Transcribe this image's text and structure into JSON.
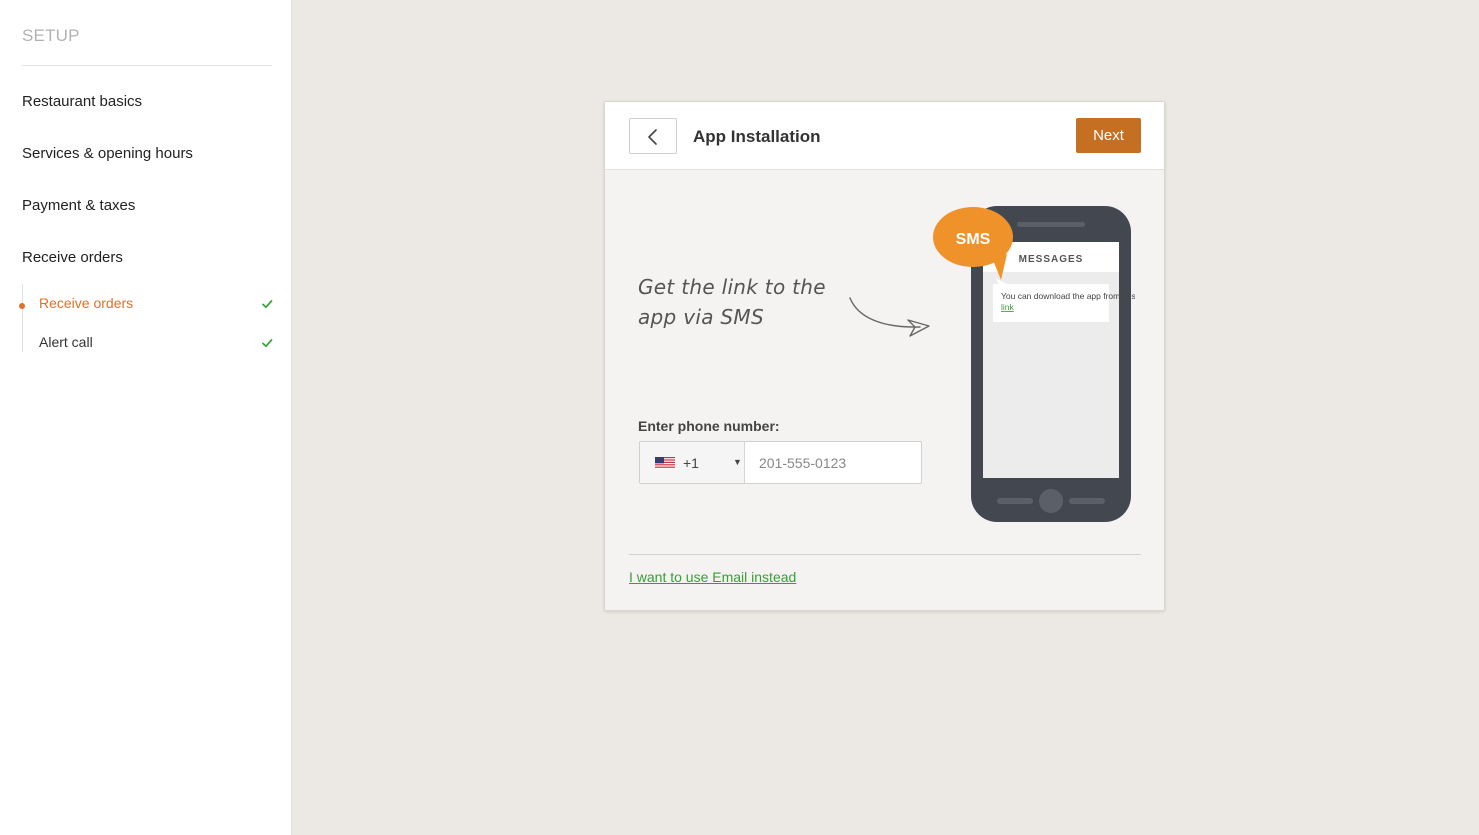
{
  "sidebar": {
    "title": "SETUP",
    "items": [
      {
        "label": "Restaurant basics"
      },
      {
        "label": "Services & opening hours"
      },
      {
        "label": "Payment & taxes"
      },
      {
        "label": "Receive orders"
      }
    ],
    "sub_items": [
      {
        "label": "Receive orders",
        "active": true,
        "completed": true
      },
      {
        "label": "Alert call",
        "active": false,
        "completed": true
      }
    ]
  },
  "card": {
    "title": "App Installation",
    "next_label": "Next",
    "headline": "Get the link to the app via SMS",
    "phone_label": "Enter phone number:",
    "country_code": "+1",
    "phone_placeholder": "201-555-0123",
    "email_link": "I want to use Email instead"
  },
  "illustration": {
    "bubble_text": "SMS",
    "screen_header": "MESSAGES",
    "message_text": "You can download the app from this",
    "message_link": "link"
  },
  "colors": {
    "accent": "#e0702a",
    "button": "#c46f22",
    "link": "#3d9a3d",
    "check": "#3aa63a",
    "bubble": "#f0922a",
    "phone_body": "#434850"
  },
  "icons": {
    "back": "chevron-left-icon",
    "check": "checkmark-icon",
    "flag": "us-flag-icon",
    "caret": "caret-down-icon"
  }
}
